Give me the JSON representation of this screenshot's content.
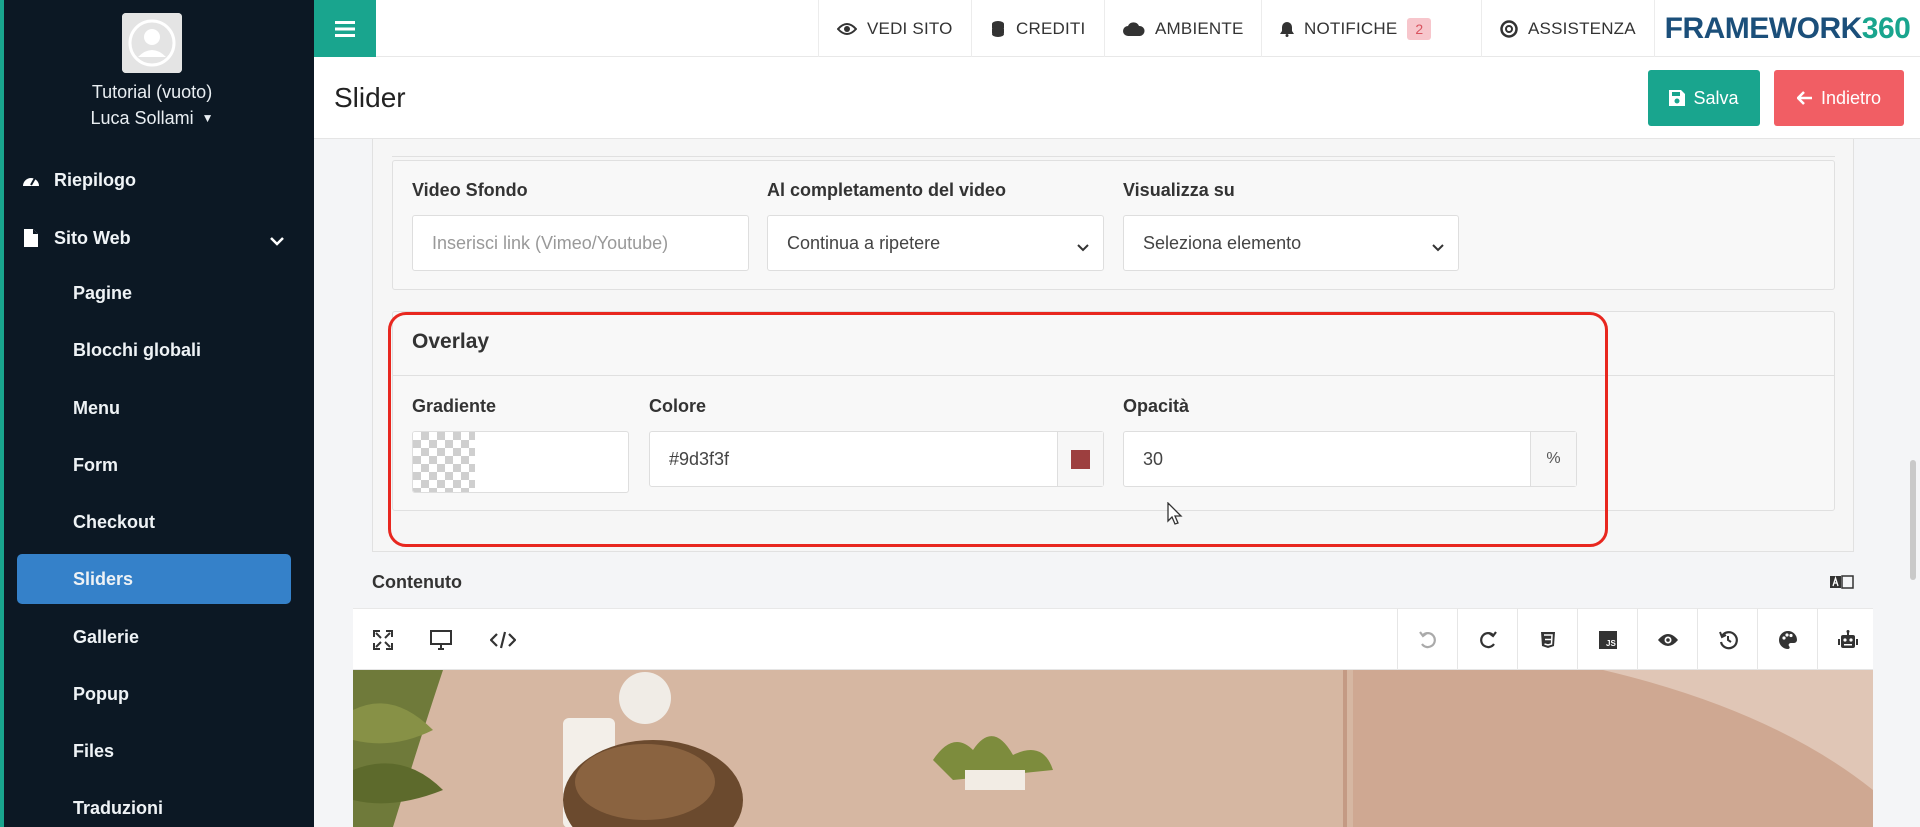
{
  "profile": {
    "site": "Tutorial (vuoto)",
    "user": "Luca Sollami"
  },
  "sidebar": {
    "items": [
      {
        "label": "Riepilogo",
        "icon": "dashboard-icon"
      },
      {
        "label": "Sito Web",
        "icon": "file-icon"
      }
    ],
    "subitems": [
      {
        "label": "Pagine"
      },
      {
        "label": "Blocchi globali"
      },
      {
        "label": "Menu"
      },
      {
        "label": "Form"
      },
      {
        "label": "Checkout"
      },
      {
        "label": "Sliders",
        "active": true
      },
      {
        "label": "Gallerie"
      },
      {
        "label": "Popup"
      },
      {
        "label": "Files"
      },
      {
        "label": "Traduzioni"
      }
    ]
  },
  "topbar": {
    "vedi_sito": "VEDI SITO",
    "crediti": "CREDITI",
    "ambiente": "AMBIENTE",
    "notifiche": "NOTIFICHE",
    "notifiche_count": "2",
    "assistenza": "ASSISTENZA",
    "brand_main": "FRAMEWORK",
    "brand_num": "360"
  },
  "header": {
    "title": "Slider",
    "save_label": "Salva",
    "back_label": "Indietro"
  },
  "video": {
    "video_sfondo_label": "Video Sfondo",
    "video_sfondo_placeholder": "Inserisci link (Vimeo/Youtube)",
    "completamento_label": "Al completamento del video",
    "completamento_value": "Continua a ripetere",
    "visualizza_label": "Visualizza su",
    "visualizza_value": "Seleziona elemento"
  },
  "overlay": {
    "title": "Overlay",
    "gradiente_label": "Gradiente",
    "colore_label": "Colore",
    "colore_value": "#9d3f3f",
    "opacita_label": "Opacità",
    "opacita_value": "30",
    "opacita_unit": "%"
  },
  "contenuto": {
    "label": "Contenuto"
  },
  "colors": {
    "accent": "#19a58e",
    "sidebar_bg": "#0c1824",
    "active_item": "#3581c9",
    "back_button": "#f15e64",
    "highlight": "#e8271f",
    "overlay_color": "#9d3f3f"
  }
}
